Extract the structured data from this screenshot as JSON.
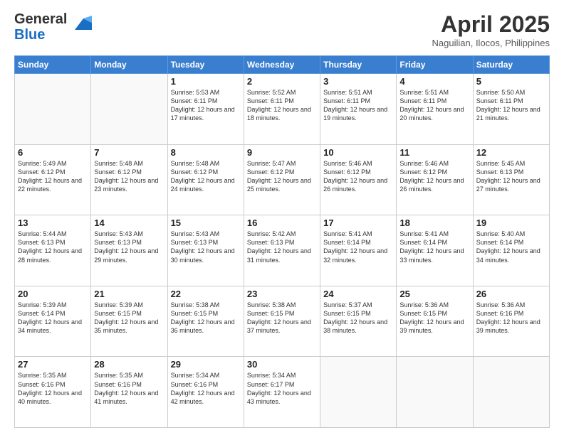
{
  "logo": {
    "general": "General",
    "blue": "Blue"
  },
  "title": "April 2025",
  "location": "Naguilian, Ilocos, Philippines",
  "days_of_week": [
    "Sunday",
    "Monday",
    "Tuesday",
    "Wednesday",
    "Thursday",
    "Friday",
    "Saturday"
  ],
  "weeks": [
    [
      {
        "day": "",
        "info": ""
      },
      {
        "day": "",
        "info": ""
      },
      {
        "day": "1",
        "info": "Sunrise: 5:53 AM\nSunset: 6:11 PM\nDaylight: 12 hours and 17 minutes."
      },
      {
        "day": "2",
        "info": "Sunrise: 5:52 AM\nSunset: 6:11 PM\nDaylight: 12 hours and 18 minutes."
      },
      {
        "day": "3",
        "info": "Sunrise: 5:51 AM\nSunset: 6:11 PM\nDaylight: 12 hours and 19 minutes."
      },
      {
        "day": "4",
        "info": "Sunrise: 5:51 AM\nSunset: 6:11 PM\nDaylight: 12 hours and 20 minutes."
      },
      {
        "day": "5",
        "info": "Sunrise: 5:50 AM\nSunset: 6:11 PM\nDaylight: 12 hours and 21 minutes."
      }
    ],
    [
      {
        "day": "6",
        "info": "Sunrise: 5:49 AM\nSunset: 6:12 PM\nDaylight: 12 hours and 22 minutes."
      },
      {
        "day": "7",
        "info": "Sunrise: 5:48 AM\nSunset: 6:12 PM\nDaylight: 12 hours and 23 minutes."
      },
      {
        "day": "8",
        "info": "Sunrise: 5:48 AM\nSunset: 6:12 PM\nDaylight: 12 hours and 24 minutes."
      },
      {
        "day": "9",
        "info": "Sunrise: 5:47 AM\nSunset: 6:12 PM\nDaylight: 12 hours and 25 minutes."
      },
      {
        "day": "10",
        "info": "Sunrise: 5:46 AM\nSunset: 6:12 PM\nDaylight: 12 hours and 26 minutes."
      },
      {
        "day": "11",
        "info": "Sunrise: 5:46 AM\nSunset: 6:12 PM\nDaylight: 12 hours and 26 minutes."
      },
      {
        "day": "12",
        "info": "Sunrise: 5:45 AM\nSunset: 6:13 PM\nDaylight: 12 hours and 27 minutes."
      }
    ],
    [
      {
        "day": "13",
        "info": "Sunrise: 5:44 AM\nSunset: 6:13 PM\nDaylight: 12 hours and 28 minutes."
      },
      {
        "day": "14",
        "info": "Sunrise: 5:43 AM\nSunset: 6:13 PM\nDaylight: 12 hours and 29 minutes."
      },
      {
        "day": "15",
        "info": "Sunrise: 5:43 AM\nSunset: 6:13 PM\nDaylight: 12 hours and 30 minutes."
      },
      {
        "day": "16",
        "info": "Sunrise: 5:42 AM\nSunset: 6:13 PM\nDaylight: 12 hours and 31 minutes."
      },
      {
        "day": "17",
        "info": "Sunrise: 5:41 AM\nSunset: 6:14 PM\nDaylight: 12 hours and 32 minutes."
      },
      {
        "day": "18",
        "info": "Sunrise: 5:41 AM\nSunset: 6:14 PM\nDaylight: 12 hours and 33 minutes."
      },
      {
        "day": "19",
        "info": "Sunrise: 5:40 AM\nSunset: 6:14 PM\nDaylight: 12 hours and 34 minutes."
      }
    ],
    [
      {
        "day": "20",
        "info": "Sunrise: 5:39 AM\nSunset: 6:14 PM\nDaylight: 12 hours and 34 minutes."
      },
      {
        "day": "21",
        "info": "Sunrise: 5:39 AM\nSunset: 6:15 PM\nDaylight: 12 hours and 35 minutes."
      },
      {
        "day": "22",
        "info": "Sunrise: 5:38 AM\nSunset: 6:15 PM\nDaylight: 12 hours and 36 minutes."
      },
      {
        "day": "23",
        "info": "Sunrise: 5:38 AM\nSunset: 6:15 PM\nDaylight: 12 hours and 37 minutes."
      },
      {
        "day": "24",
        "info": "Sunrise: 5:37 AM\nSunset: 6:15 PM\nDaylight: 12 hours and 38 minutes."
      },
      {
        "day": "25",
        "info": "Sunrise: 5:36 AM\nSunset: 6:15 PM\nDaylight: 12 hours and 39 minutes."
      },
      {
        "day": "26",
        "info": "Sunrise: 5:36 AM\nSunset: 6:16 PM\nDaylight: 12 hours and 39 minutes."
      }
    ],
    [
      {
        "day": "27",
        "info": "Sunrise: 5:35 AM\nSunset: 6:16 PM\nDaylight: 12 hours and 40 minutes."
      },
      {
        "day": "28",
        "info": "Sunrise: 5:35 AM\nSunset: 6:16 PM\nDaylight: 12 hours and 41 minutes."
      },
      {
        "day": "29",
        "info": "Sunrise: 5:34 AM\nSunset: 6:16 PM\nDaylight: 12 hours and 42 minutes."
      },
      {
        "day": "30",
        "info": "Sunrise: 5:34 AM\nSunset: 6:17 PM\nDaylight: 12 hours and 43 minutes."
      },
      {
        "day": "",
        "info": ""
      },
      {
        "day": "",
        "info": ""
      },
      {
        "day": "",
        "info": ""
      }
    ]
  ]
}
